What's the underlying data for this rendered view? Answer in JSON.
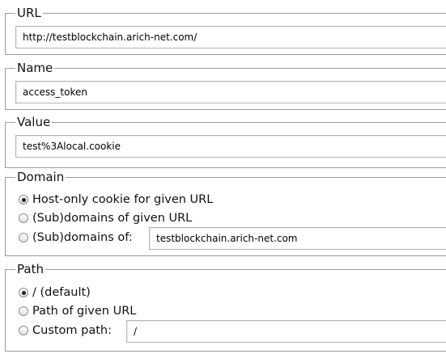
{
  "url_section": {
    "legend": "URL",
    "value": "http://testblockchain.arich-net.com/"
  },
  "name_section": {
    "legend": "Name",
    "value": "access_token"
  },
  "value_section": {
    "legend": "Value",
    "value": "test%3Alocal.cookie"
  },
  "domain_section": {
    "legend": "Domain",
    "options": [
      {
        "label": "Host-only cookie for given URL",
        "checked": true
      },
      {
        "label": "(Sub)domains of given URL",
        "checked": false
      },
      {
        "label": "(Sub)domains of:",
        "checked": false
      }
    ],
    "custom_value": "testblockchain.arich-net.com"
  },
  "path_section": {
    "legend": "Path",
    "options": [
      {
        "label": "/ (default)",
        "checked": true
      },
      {
        "label": "Path of given URL",
        "checked": false
      },
      {
        "label": "Custom path:",
        "checked": false
      }
    ],
    "custom_value": "/"
  }
}
